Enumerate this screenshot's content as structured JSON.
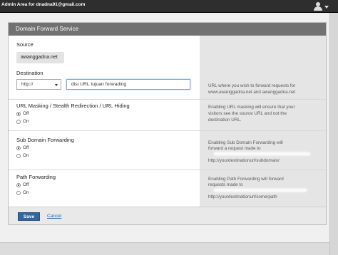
{
  "topbar": {
    "admin_text": "Admin Area for dnadna91@gmail.com"
  },
  "panel": {
    "title": "Domain Forward Service"
  },
  "source": {
    "label": "Source",
    "domain": "awanggadna.net"
  },
  "destination": {
    "label": "Destination",
    "protocol_selected": "http://",
    "url_value": "disi URL tujuan forwading",
    "hint_line1": "URL where you wish to forward requests for",
    "hint_line2": "www.awanggadna.net and awanggadna.net"
  },
  "masking": {
    "label": "URL Masking / Stealth Redirection / URL Hiding",
    "option_off": "Off",
    "option_on": "On",
    "selected": "Off",
    "hint_line1": "Enabling URL masking will ensure that your",
    "hint_line2": "visitors see the source URL and not the",
    "hint_line3": "destination URL."
  },
  "subdomain": {
    "label": "Sub Domain Forwarding",
    "option_off": "Off",
    "option_on": "On",
    "selected": "Off",
    "hint_line1": "Enabling Sub Domain Forwarding will",
    "hint_line2": "forward a request made to",
    "hint_line3": "http://yourdestinationurl/subdomain/"
  },
  "path": {
    "label": "Path Forwarding",
    "option_off": "Off",
    "option_on": "On",
    "selected": "Off",
    "hint_line1": "Enabling Path Forwarding will forward",
    "hint_line2": "requests made to",
    "hint_line3": "http://yourdestinationurl/some/path"
  },
  "actions": {
    "save_label": "Save",
    "cancel_label": "Cancel"
  }
}
